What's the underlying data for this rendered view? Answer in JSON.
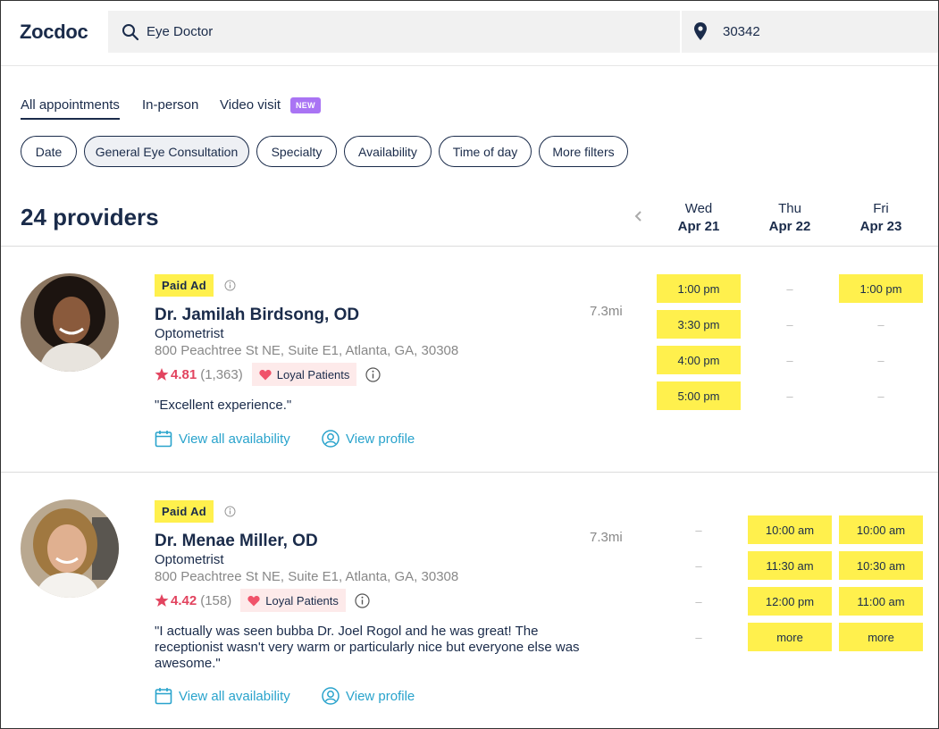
{
  "header": {
    "logo": "Zocdoc",
    "search_value": "Eye Doctor",
    "zip_value": "30342"
  },
  "tabs": [
    {
      "label": "All appointments",
      "active": true
    },
    {
      "label": "In-person",
      "active": false
    },
    {
      "label": "Video visit",
      "active": false
    }
  ],
  "video_badge": "NEW",
  "filters": [
    {
      "label": "Date"
    },
    {
      "label": "General Eye Consultation"
    },
    {
      "label": "Specialty"
    },
    {
      "label": "Availability"
    },
    {
      "label": "Time of day"
    },
    {
      "label": "More filters"
    }
  ],
  "results": {
    "count_label": "24 providers"
  },
  "days": [
    {
      "weekday": "Wed",
      "date": "Apr 21"
    },
    {
      "weekday": "Thu",
      "date": "Apr 22"
    },
    {
      "weekday": "Fri",
      "date": "Apr 23"
    }
  ],
  "providers": [
    {
      "paid_ad": "Paid Ad",
      "name": "Dr. Jamilah Birdsong, OD",
      "specialty": "Optometrist",
      "address": "800 Peachtree St NE, Suite E1, Atlanta, GA, 30308",
      "distance": "7.3mi",
      "rating": "4.81",
      "reviews": "(1,363)",
      "badge": "Loyal Patients",
      "review_text": "\"Excellent experience.\"",
      "view_availability": "View all availability",
      "view_profile": "View profile",
      "slots": {
        "wed": [
          "1:00 pm",
          "3:30 pm",
          "4:00 pm",
          "5:00 pm"
        ],
        "thu": [
          "–",
          "–",
          "–",
          "–"
        ],
        "fri": [
          "1:00 pm",
          "–",
          "–",
          "–"
        ]
      }
    },
    {
      "paid_ad": "Paid Ad",
      "name": "Dr. Menae Miller, OD",
      "specialty": "Optometrist",
      "address": "800 Peachtree St NE, Suite E1, Atlanta, GA, 30308",
      "distance": "7.3mi",
      "rating": "4.42",
      "reviews": "(158)",
      "badge": "Loyal Patients",
      "review_text_lines": [
        "\"I actually was seen bubba Dr. Joel Rogol and he was great! The",
        "receptionist wasn't very warm or particularly nice but everyone else was",
        "awesome.\""
      ],
      "view_availability": "View all availability",
      "view_profile": "View profile",
      "slots": {
        "wed": [
          "–",
          "–",
          "–",
          "–"
        ],
        "thu": [
          "10:00 am",
          "11:30 am",
          "12:00 pm",
          "more"
        ],
        "fri": [
          "10:00 am",
          "10:30 am",
          "11:00 am",
          "more"
        ]
      }
    }
  ],
  "colors": {
    "navy": "#1a2b4a",
    "slot_yellow": "#fff04d",
    "link_blue": "#29a3cc",
    "rating_red": "#e2445f",
    "new_badge_purple": "#a974f4"
  }
}
